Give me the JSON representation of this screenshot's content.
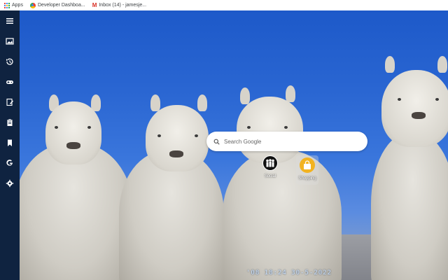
{
  "bookmarks": {
    "apps_label": "Apps",
    "developer_label": "Developer Dashboa...",
    "inbox_label": "Inbox (14) - jamesje..."
  },
  "sidebar": {
    "items": [
      {
        "icon": "menu-icon"
      },
      {
        "icon": "photo-album-icon"
      },
      {
        "icon": "history-icon"
      },
      {
        "icon": "gamepad-icon"
      },
      {
        "icon": "edit-note-icon"
      },
      {
        "icon": "clipboard-icon"
      },
      {
        "icon": "bookmark-icon"
      },
      {
        "icon": "google-g-icon"
      },
      {
        "icon": "gear-icon"
      }
    ]
  },
  "search": {
    "placeholder": "Search Google"
  },
  "shortcuts": [
    {
      "label": "Social",
      "icon": "people-icon"
    },
    {
      "label": "Shopping",
      "icon": "shopping-bag-icon"
    }
  ],
  "datestamp": "'08 18:24 30-5-2022",
  "colors": {
    "sidebar": "#0f2340",
    "sky": "#2a66d2",
    "shopping_tile": "#f2b321"
  }
}
